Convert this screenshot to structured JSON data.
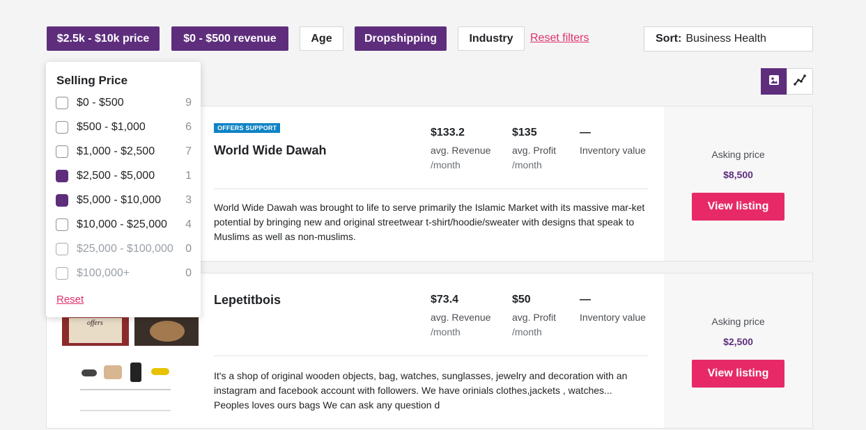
{
  "filters": {
    "chips": [
      {
        "label": "$2.5k - $10k price",
        "active": true
      },
      {
        "label": "$0 - $500 revenue",
        "active": true
      },
      {
        "label": "Age",
        "active": false
      },
      {
        "label": "Dropshipping",
        "active": true
      },
      {
        "label": "Industry",
        "active": false
      }
    ],
    "reset_label": "Reset filters"
  },
  "sort": {
    "label": "Sort:",
    "value": "Business Health"
  },
  "view_toggle": {
    "grid_icon": "image-icon",
    "chart_icon": "trend-line-icon"
  },
  "price_dropdown": {
    "title": "Selling Price",
    "options": [
      {
        "label": "$0 - $500",
        "count": "9",
        "checked": false,
        "disabled": false
      },
      {
        "label": "$500 - $1,000",
        "count": "6",
        "checked": false,
        "disabled": false
      },
      {
        "label": "$1,000 - $2,500",
        "count": "7",
        "checked": false,
        "disabled": false
      },
      {
        "label": "$2,500 - $5,000",
        "count": "1",
        "checked": true,
        "disabled": false
      },
      {
        "label": "$5,000 - $10,000",
        "count": "3",
        "checked": true,
        "disabled": false
      },
      {
        "label": "$10,000 - $25,000",
        "count": "4",
        "checked": false,
        "disabled": false
      },
      {
        "label": "$25,000 - $100,000",
        "count": "0",
        "checked": false,
        "disabled": true
      },
      {
        "label": "$100,000+",
        "count": "0",
        "checked": false,
        "disabled": true
      }
    ],
    "reset_label": "Reset"
  },
  "listings": [
    {
      "badge": "OFFERS SUPPORT",
      "title": "World Wide Dawah",
      "revenue": {
        "value": "$133.2",
        "label": "avg. Revenue",
        "unit": "/month"
      },
      "profit": {
        "value": "$135",
        "label": "avg. Profit",
        "unit": "/month"
      },
      "inventory": {
        "value": "—",
        "label": "Inventory value"
      },
      "description": "World Wide Dawah was brought to life to serve primarily the Islamic Market with its massive mar-ket potential by bringing new and original streetwear t-shirt/hoodie/sweater with designs that speak to Muslims as well as non-muslims.",
      "asking_label": "Asking price",
      "asking_price": "$8,500",
      "cta": "View listing"
    },
    {
      "badge": "",
      "title": "Lepetitbois",
      "revenue": {
        "value": "$73.4",
        "label": "avg. Revenue",
        "unit": "/month"
      },
      "profit": {
        "value": "$50",
        "label": "avg. Profit",
        "unit": "/month"
      },
      "inventory": {
        "value": "—",
        "label": "Inventory value"
      },
      "description": "It's a shop of original wooden objects, bag, watches, sunglasses, jewelry and decoration with an instagram and facebook account with followers. We have orinials clothes,jackets , watches... Peoples loves ours bags We can ask any question d",
      "asking_label": "Asking price",
      "asking_price": "$2,500",
      "cta": "View listing",
      "thumb_text": "offers"
    }
  ]
}
